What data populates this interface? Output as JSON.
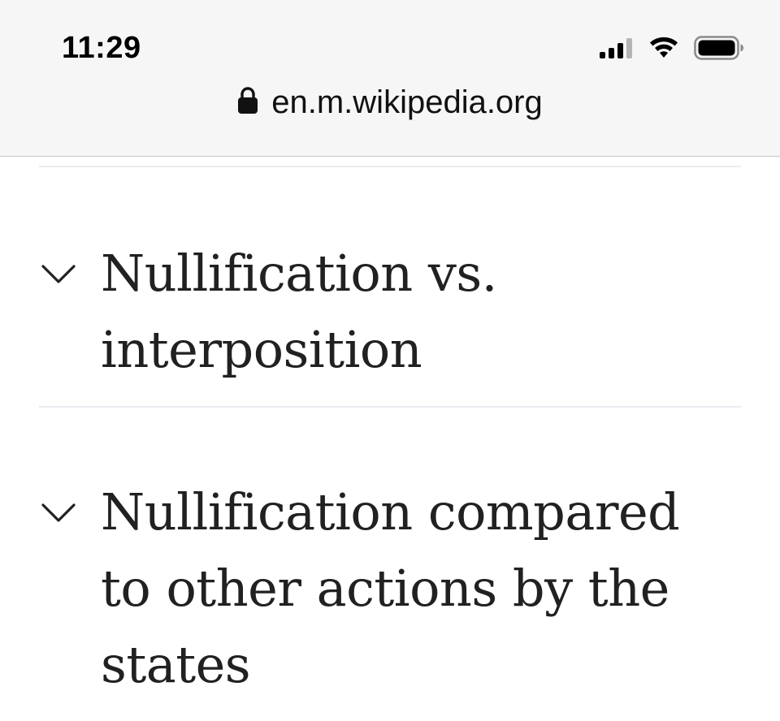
{
  "status_bar": {
    "time": "11:29",
    "icons": [
      "cellular-signal-icon",
      "wifi-icon",
      "battery-icon"
    ]
  },
  "address_bar": {
    "lock_icon": "lock-icon",
    "url": "en.m.wikipedia.org"
  },
  "sections": [
    {
      "heading": "Nullification vs. interposition",
      "icon": "chevron-down-icon"
    },
    {
      "heading": "Nullification compared to other actions by the states",
      "icon": "chevron-down-icon"
    }
  ],
  "colors": {
    "top_bar_bg": "#f6f6f6",
    "text": "#202122",
    "divider": "#eaecf0"
  }
}
